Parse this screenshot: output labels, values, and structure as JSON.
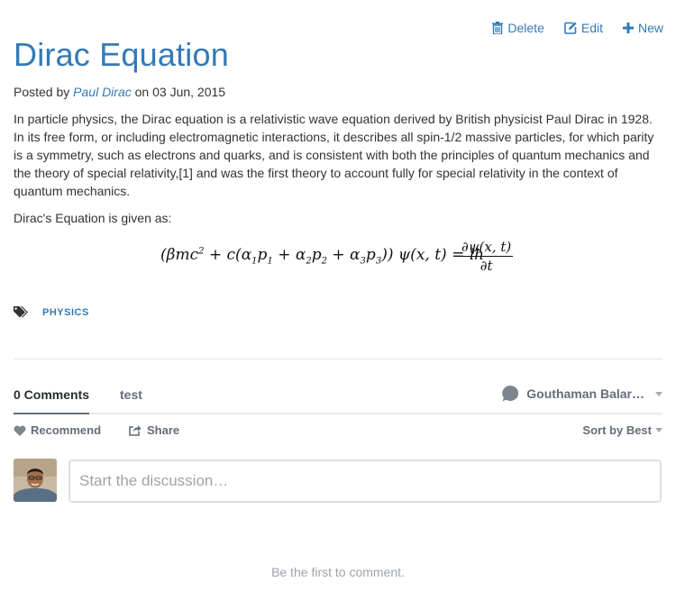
{
  "actions": {
    "delete_label": "Delete",
    "edit_label": "Edit",
    "new_label": "New"
  },
  "post": {
    "title": "Dirac Equation",
    "meta_prefix": "Posted by",
    "author": "Paul Dirac",
    "meta_mid": "on",
    "date": "03 Jun, 2015",
    "paragraph1": "In particle physics, the Dirac equation is a relativistic wave equation derived by British physicist Paul Dirac in 1928. In its free form, or including electromagnetic interactions, it describes all spin-1/2 massive particles, for which parity is a symmetry, such as electrons and quarks, and is consistent with both the principles of quantum mechanics and the theory of special relativity,[1] and was the first theory to account fully for special relativity in the context of quantum mechanics.",
    "paragraph2": "Dirac's Equation is given as:",
    "tags": [
      "PHYSICS"
    ]
  },
  "comments": {
    "tab_count_label": "0 Comments",
    "tab_forum_label": "test",
    "user_name": "Gouthaman Balar…",
    "recommend_label": "Recommend",
    "share_label": "Share",
    "sort_label": "Sort by Best",
    "input_placeholder": "Start the discussion…",
    "empty_message": "Be the first to comment."
  },
  "icons": {
    "delete": "trash-icon",
    "edit": "edit-icon",
    "new": "plus-icon",
    "tags": "tags-icon",
    "user": "chat-bubble-icon",
    "recommend": "heart-icon",
    "share": "share-icon"
  },
  "colors": {
    "link": "#337ab7",
    "text": "#333333",
    "muted": "#656c7a",
    "placeholder": "#9ea3a8"
  }
}
